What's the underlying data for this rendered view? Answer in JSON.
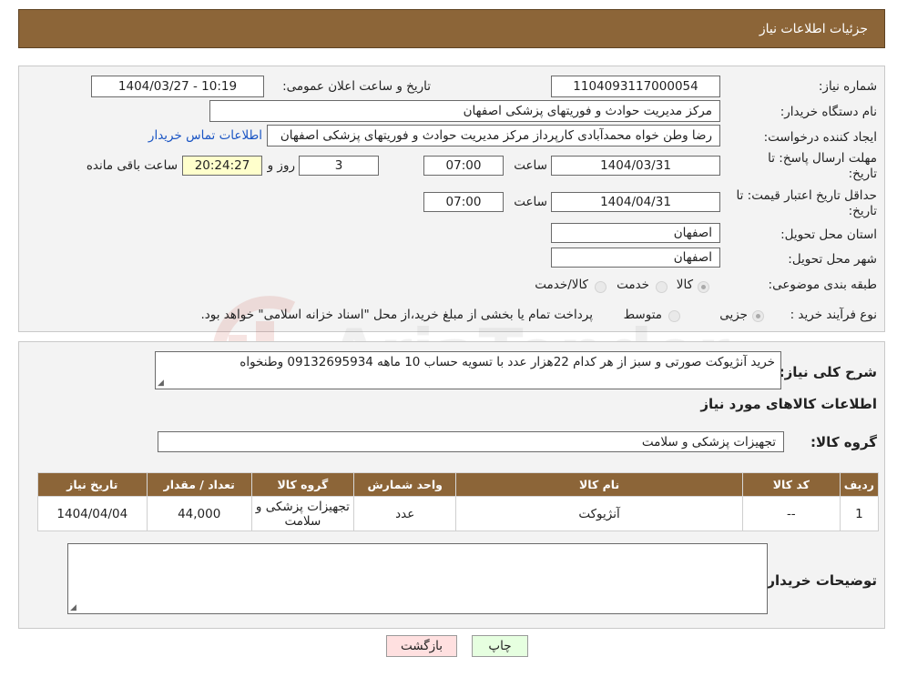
{
  "page": {
    "title": "جزئیات اطلاعات نیاز"
  },
  "watermark": {
    "text": "AriaTender.neT"
  },
  "form": {
    "need_number_label": "شماره نیاز:",
    "need_number": "1104093117000054",
    "announce_label": "تاریخ و ساعت اعلان عمومی:",
    "announce_value": "1404/03/27 - 10:19",
    "buyer_org_label": "نام دستگاه خریدار:",
    "buyer_org": "مرکز مدیریت حوادث و فوریتهای پزشکی اصفهان",
    "creator_label": "ایجاد کننده درخواست:",
    "creator": "رضا وطن خواه محمدآبادی کارپرداز مرکز مدیریت حوادث و فوریتهای پزشکی اصفهان",
    "contact_link": "اطلاعات تماس خریدار",
    "deadline_label_line1": "مهلت ارسال پاسخ: تا",
    "deadline_label_line2": "تاریخ:",
    "deadline_date": "1404/03/31",
    "time_label": "ساعت",
    "deadline_time": "07:00",
    "days_value": "3",
    "days_label": "روز و",
    "remaining_time": "20:24:27",
    "remaining_label": "ساعت باقی مانده",
    "validity_label_line1": "حداقل تاریخ اعتبار قیمت: تا",
    "validity_label_line2": "تاریخ:",
    "validity_date": "1404/04/31",
    "validity_time_label": "ساعت",
    "validity_time": "07:00",
    "province_label": "استان محل تحویل:",
    "province": "اصفهان",
    "city_label": "شهر محل تحویل:",
    "city": "اصفهان",
    "category_label": "طبقه بندی موضوعی:",
    "category_options": [
      "کالا",
      "خدمت",
      "کالا/خدمت"
    ],
    "process_label": "نوع فرآیند خرید :",
    "process_options": [
      "جزیی",
      "متوسط"
    ],
    "process_note": "پرداخت تمام یا بخشی از مبلغ خرید،از محل \"اسناد خزانه اسلامی\" خواهد بود."
  },
  "details": {
    "summary_label": "شرح کلی نیاز:",
    "summary": "خرید آنژیوکت صورتی و سبز از هر کدام 22هزار عدد با تسویه حساب 10 ماهه 09132695934 وطنخواه",
    "goods_info_title": "اطلاعات کالاهای مورد نیاز",
    "goods_group_label": "گروه کالا:",
    "goods_group": "تجهیزات پزشکی و سلامت",
    "table": {
      "headers": [
        "ردیف",
        "کد کالا",
        "نام کالا",
        "واحد شمارش",
        "گروه کالا",
        "تعداد / مقدار",
        "تاریخ نیاز"
      ],
      "rows": [
        [
          "1",
          "--",
          "آنژیوکت",
          "عدد",
          "تجهیزات پزشکی و سلامت",
          "44,000",
          "1404/04/04"
        ]
      ]
    },
    "buyer_notes_label": "توضیحات خریدار:",
    "buyer_notes": ""
  },
  "buttons": {
    "print": "چاپ",
    "back": "بازگشت"
  },
  "colors": {
    "header_bg": "#8c6538",
    "back_button_bg": "#ffe0e0",
    "print_button_bg": "#e6ffe0"
  }
}
